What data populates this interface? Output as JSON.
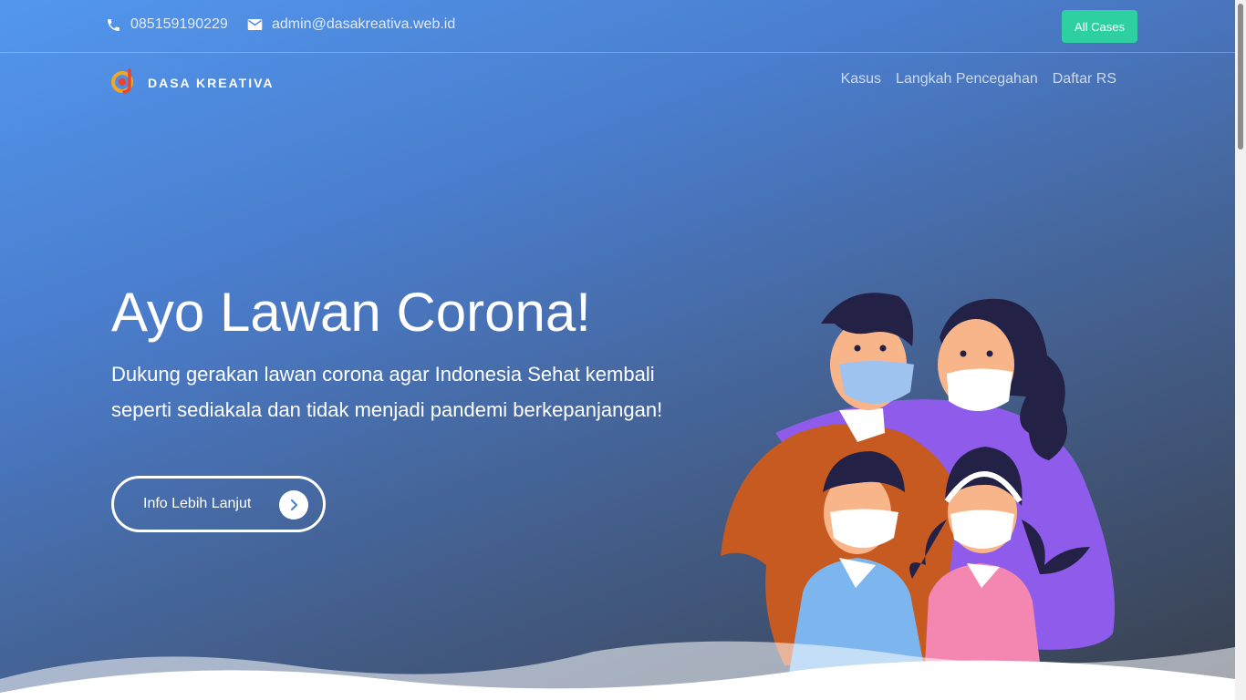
{
  "topbar": {
    "phone": "085159190229",
    "email": "admin@dasakreativa.web.id",
    "phone_icon": "phone-icon",
    "email_icon": "envelope-icon",
    "cta_label": "All Cases"
  },
  "brand": {
    "name": "DASA KREATIVA",
    "logo_icon": "dasa-kreativa-logo"
  },
  "nav": {
    "items": [
      "Kasus",
      "Langkah Pencegahan",
      "Daftar RS"
    ]
  },
  "hero": {
    "title": "Ayo Lawan Corona!",
    "subtitle": "Dukung gerakan lawan corona agar Indonesia Sehat kembali seperti sediakala dan tidak menjadi pandemi berkepanjangan!",
    "cta_label": "Info Lebih Lanjut",
    "cta_icon": "chevron-right-icon",
    "illustration": "family-wearing-masks"
  },
  "colors": {
    "gradient_start": "#5297ef",
    "gradient_end": "#393f4c",
    "accent": "#2ecfa0",
    "logo_orange": "#f5a623",
    "logo_red": "#e8442f"
  }
}
